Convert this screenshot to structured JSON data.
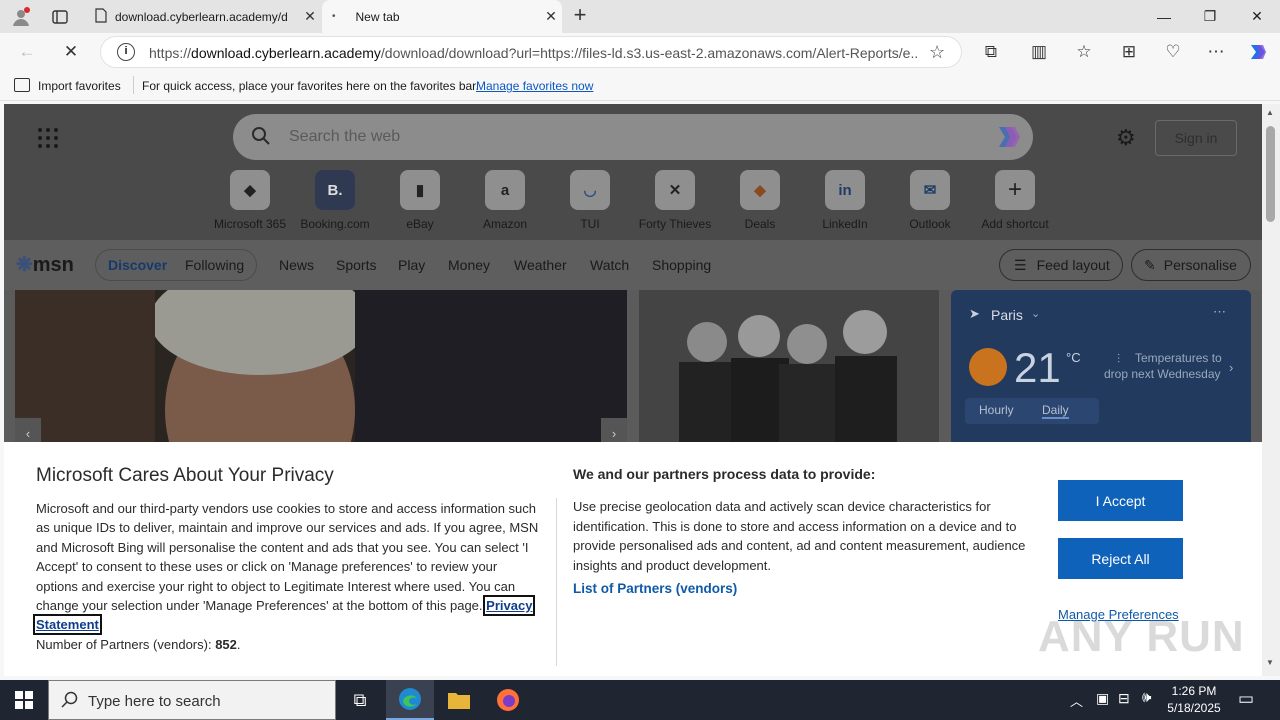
{
  "browser": {
    "tabs": [
      {
        "title": "download.cyberlearn.academy/d"
      },
      {
        "title": "New tab"
      }
    ],
    "url_prefix": "https://",
    "url_domain": "download.cyberlearn.academy",
    "url_rest": "/download/download?url=https://files-ld.s3.us-east-2.amazonaws.com/Alert-Reports/e...",
    "favorites_bar": {
      "import_label": "Import favorites",
      "hint": "For quick access, place your favorites here on the favorites bar.",
      "manage_link": "Manage favorites now"
    }
  },
  "newtab": {
    "search_placeholder": "Search the web",
    "sign_in": "Sign in",
    "shortcuts": [
      {
        "label": "Microsoft 365",
        "glyph": "◆"
      },
      {
        "label": "Booking.com",
        "glyph": "B."
      },
      {
        "label": "eBay",
        "glyph": "▮"
      },
      {
        "label": "Amazon",
        "glyph": "a"
      },
      {
        "label": "TUI",
        "glyph": "◡"
      },
      {
        "label": "Forty Thieves",
        "glyph": "✕"
      },
      {
        "label": "Deals",
        "glyph": "◆"
      },
      {
        "label": "LinkedIn",
        "glyph": "in"
      },
      {
        "label": "Outlook",
        "glyph": "✉"
      },
      {
        "label": "Add shortcut",
        "glyph": "+"
      }
    ],
    "msn": {
      "logo": "msn",
      "tabs": [
        "Discover",
        "Following"
      ],
      "nav": [
        "News",
        "Sports",
        "Play",
        "Money",
        "Weather",
        "Watch",
        "Shopping"
      ],
      "feed_layout": "Feed layout",
      "personalise": "Personalise"
    },
    "weather": {
      "city": "Paris",
      "temp": "21",
      "unit": "°C",
      "summary_line1": "Temperatures to",
      "summary_line2": "drop next Wednesday",
      "toggle": [
        "Hourly",
        "Daily"
      ]
    }
  },
  "privacy": {
    "title": "Microsoft Cares About Your Privacy",
    "body": "Microsoft and our third-party vendors use cookies to store and access information such as unique IDs to deliver, maintain and improve our services and ads. If you agree, MSN and Microsoft Bing will personalise the content and ads that you see. You can select 'I Accept' to consent to these uses or click on 'Manage preferences' to review your options and exercise your right to object to Legitimate Interest where used.  You can change your selection under 'Manage Preferences' at the bottom of this page.",
    "privacy_link": "Privacy Statement",
    "partners_prefix": "Number of Partners (vendors): ",
    "partners_count": "852",
    "partners_suffix": ".",
    "right_heading": "We and our partners process data to provide:",
    "right_text": "Use precise geolocation data and actively scan device characteristics for identification. This is done to store and access information on a device and to provide personalised ads and content, ad and content measurement, audience insights and product development.",
    "list_link": "List of Partners (vendors)",
    "accept": "I Accept",
    "reject": "Reject All",
    "manage": "Manage Preferences"
  },
  "taskbar": {
    "search_placeholder": "Type here to search",
    "time": "1:26 PM",
    "date": "5/18/2025"
  },
  "watermark": "ANY RUN"
}
